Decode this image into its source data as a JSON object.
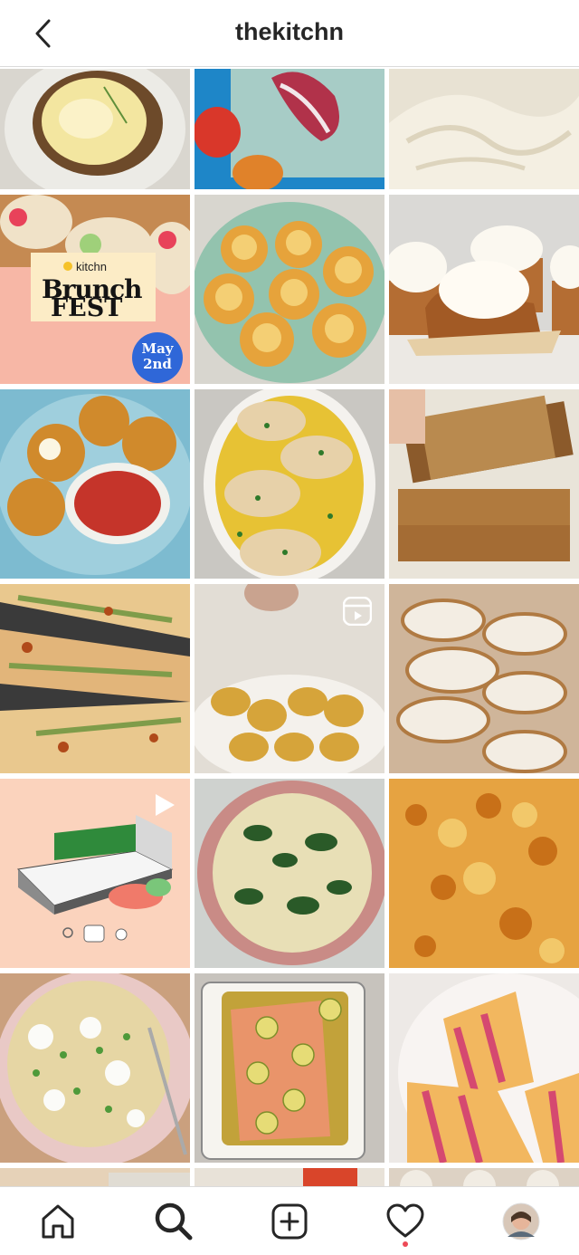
{
  "header": {
    "title": "thekitchn",
    "back_icon": "chevron-left-icon"
  },
  "promo": {
    "logo": "kitchn",
    "line1": "Brunch",
    "line2": "FEST",
    "badge_line1": "May",
    "badge_line2": "2nd"
  },
  "tabbar": {
    "items": [
      "home-icon",
      "search-icon",
      "new-post-icon",
      "activity-icon",
      "profile-avatar"
    ]
  },
  "colors": {
    "accent_notification": "#ed4956",
    "divider": "#dbdbdb",
    "text": "#262626"
  }
}
